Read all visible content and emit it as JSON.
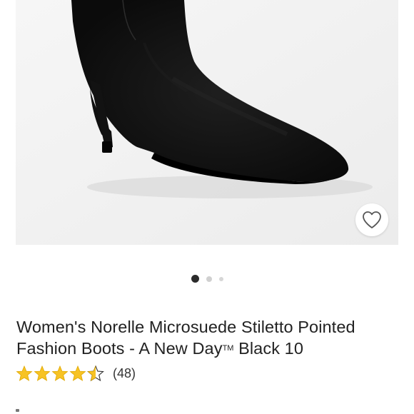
{
  "product": {
    "title_main": "Women's Norelle Microsuede Stiletto Pointed Fashion Boots - A New Day",
    "title_tm": "TM",
    "title_suffix": " Black 10",
    "rating_value": 4.5,
    "rating_max": 5,
    "review_count": "(48)"
  },
  "gallery": {
    "image_count": 3,
    "active_index": 0
  },
  "icons": {
    "wishlist": "heart-outline-icon",
    "star": "star-icon"
  },
  "colors": {
    "star": "#F7C325",
    "text": "#222222",
    "dot_active": "#2B2B2B"
  }
}
